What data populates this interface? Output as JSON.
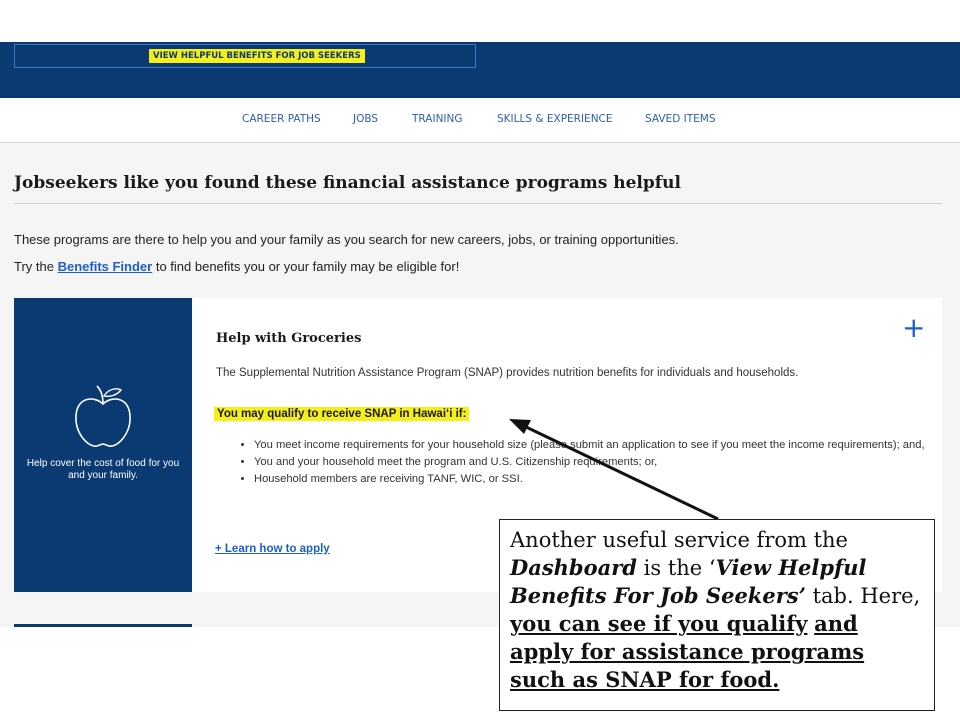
{
  "header": {
    "benefits_tab_label": "VIEW HELPFUL BENEFITS FOR JOB SEEKERS"
  },
  "subnav": {
    "items": [
      "CAREER PATHS",
      "JOBS",
      "TRAINING",
      "SKILLS & EXPERIENCE",
      "SAVED ITEMS"
    ]
  },
  "main": {
    "title": "Jobseekers like you found these financial assistance programs helpful",
    "intro_line1": "These programs are there to help you and your family as you search for new careers, jobs, or training opportunities.",
    "intro_line2_prefix": "Try the ",
    "intro_link": "Benefits Finder",
    "intro_line2_suffix": " to find benefits you or your family may be eligible for!"
  },
  "card": {
    "icon": "apple-icon",
    "side_caption": "Help cover the cost of food for you and your family.",
    "title": "Help with Groceries",
    "expand_symbol": "+",
    "description": "The Supplemental Nutrition Assistance Program (SNAP) provides nutrition benefits for individuals and households.",
    "qualify_heading": "You may qualify to receive SNAP in Hawai‘i if:",
    "bullets": [
      "You meet income requirements for your household size (please submit an application to see if you meet the income requirements); and,",
      "You and your household meet the program and U.S. Citizenship requirements; or,",
      "Household members are receiving TANF, WIC, or SSI."
    ],
    "learn_link": "+ Learn how to apply"
  },
  "callout": {
    "part1": "Another useful service from the ",
    "dashboard": "Dashboard",
    "part2": " is the ‘",
    "tab_name": "View Helpful Benefits For Job Seekers’",
    "part3": " tab. Here, ",
    "ul1": "you can see if you qualify",
    "space": " ",
    "ul2": "and apply for assistance programs such as SNAP for food."
  },
  "colors": {
    "navy": "#0b3a73",
    "highlight": "#f6ee17",
    "link": "#1d5fc9"
  }
}
